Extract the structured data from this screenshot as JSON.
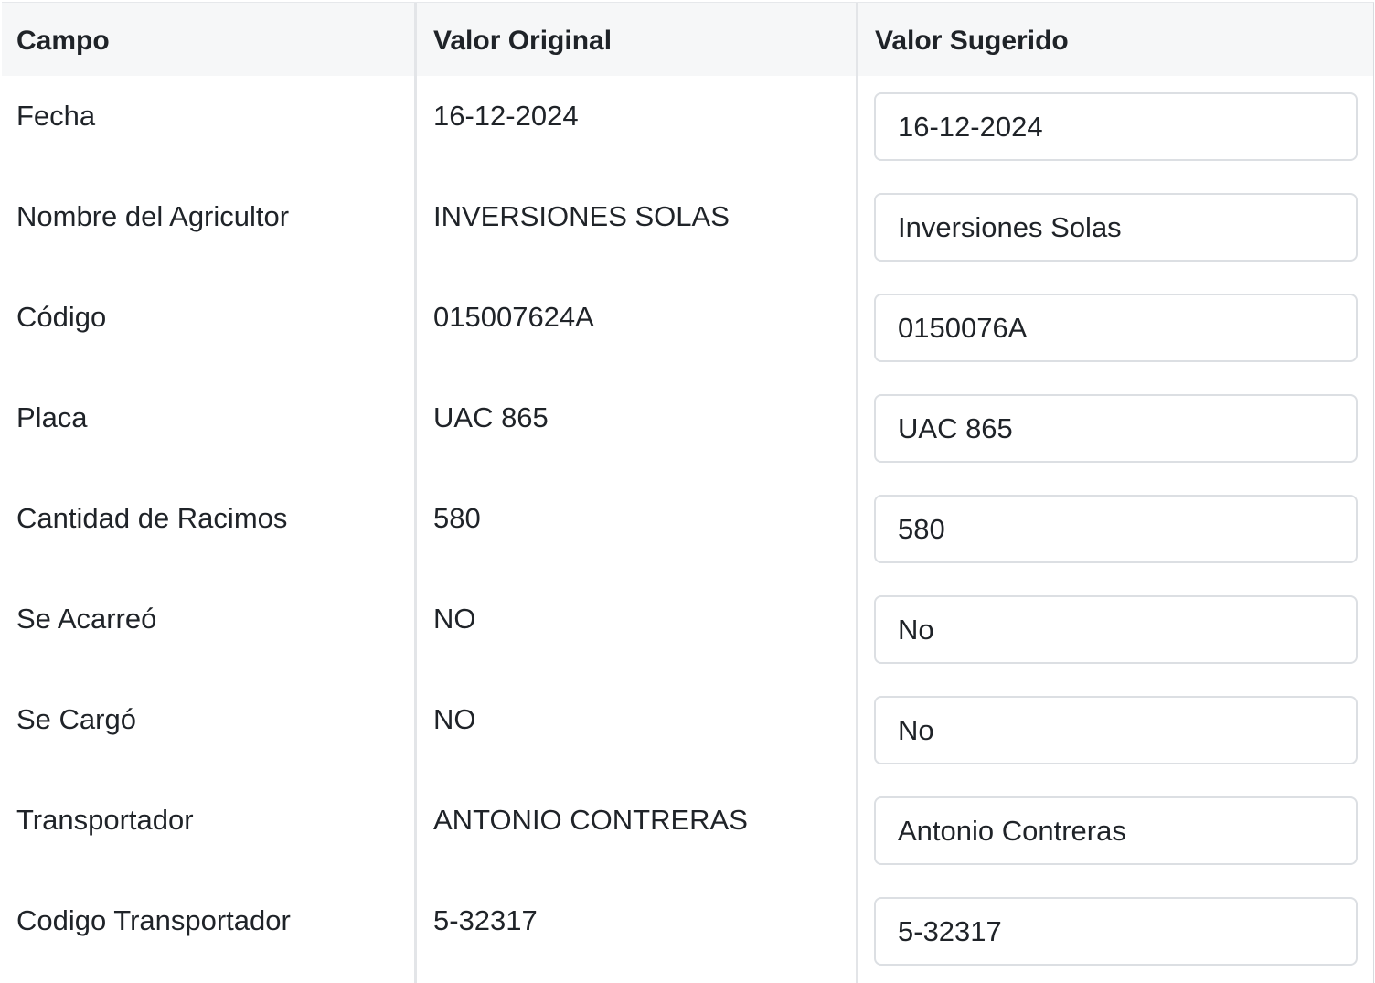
{
  "table": {
    "headers": {
      "field": "Campo",
      "original": "Valor Original",
      "suggested": "Valor Sugerido"
    },
    "rows": [
      {
        "field": "Fecha",
        "original": "16-12-2024",
        "suggested": "16-12-2024"
      },
      {
        "field": "Nombre del Agricultor",
        "original": "INVERSIONES SOLAS",
        "suggested": "Inversiones Solas"
      },
      {
        "field": "Código",
        "original": "015007624A",
        "suggested": "0150076A"
      },
      {
        "field": "Placa",
        "original": "UAC 865",
        "suggested": "UAC 865"
      },
      {
        "field": "Cantidad de Racimos",
        "original": "580",
        "suggested": "580"
      },
      {
        "field": "Se Acarreó",
        "original": "NO",
        "suggested": "No"
      },
      {
        "field": "Se Cargó",
        "original": "NO",
        "suggested": "No"
      },
      {
        "field": "Transportador",
        "original": "ANTONIO CONTRERAS",
        "suggested": "Antonio Contreras"
      },
      {
        "field": "Codigo Transportador",
        "original": "5-32317",
        "suggested": "5-32317"
      }
    ]
  }
}
